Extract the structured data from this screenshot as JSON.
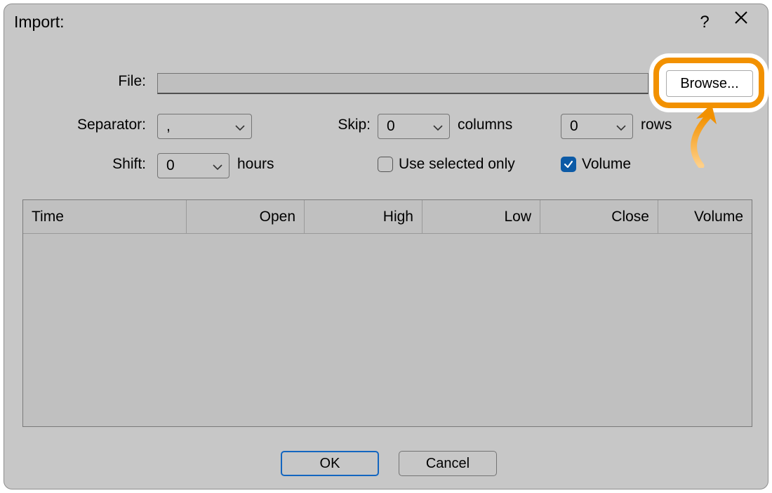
{
  "dialog": {
    "title": "Import:"
  },
  "file": {
    "label": "File:",
    "value": "",
    "browse_label": "Browse..."
  },
  "separator": {
    "label": "Separator:",
    "value": ","
  },
  "skip": {
    "label": "Skip:",
    "columns_value": "0",
    "columns_label": "columns",
    "rows_value": "0",
    "rows_label": "rows"
  },
  "shift": {
    "label": "Shift:",
    "value": "0",
    "unit": "hours"
  },
  "options": {
    "use_selected_only": {
      "label": "Use selected only",
      "checked": false
    },
    "volume": {
      "label": "Volume",
      "checked": true
    }
  },
  "table": {
    "columns": [
      "Time",
      "Open",
      "High",
      "Low",
      "Close",
      "Volume"
    ]
  },
  "buttons": {
    "ok": "OK",
    "cancel": "Cancel"
  },
  "colors": {
    "accent_orange": "#f29100",
    "accent_blue": "#0c5aa6"
  }
}
